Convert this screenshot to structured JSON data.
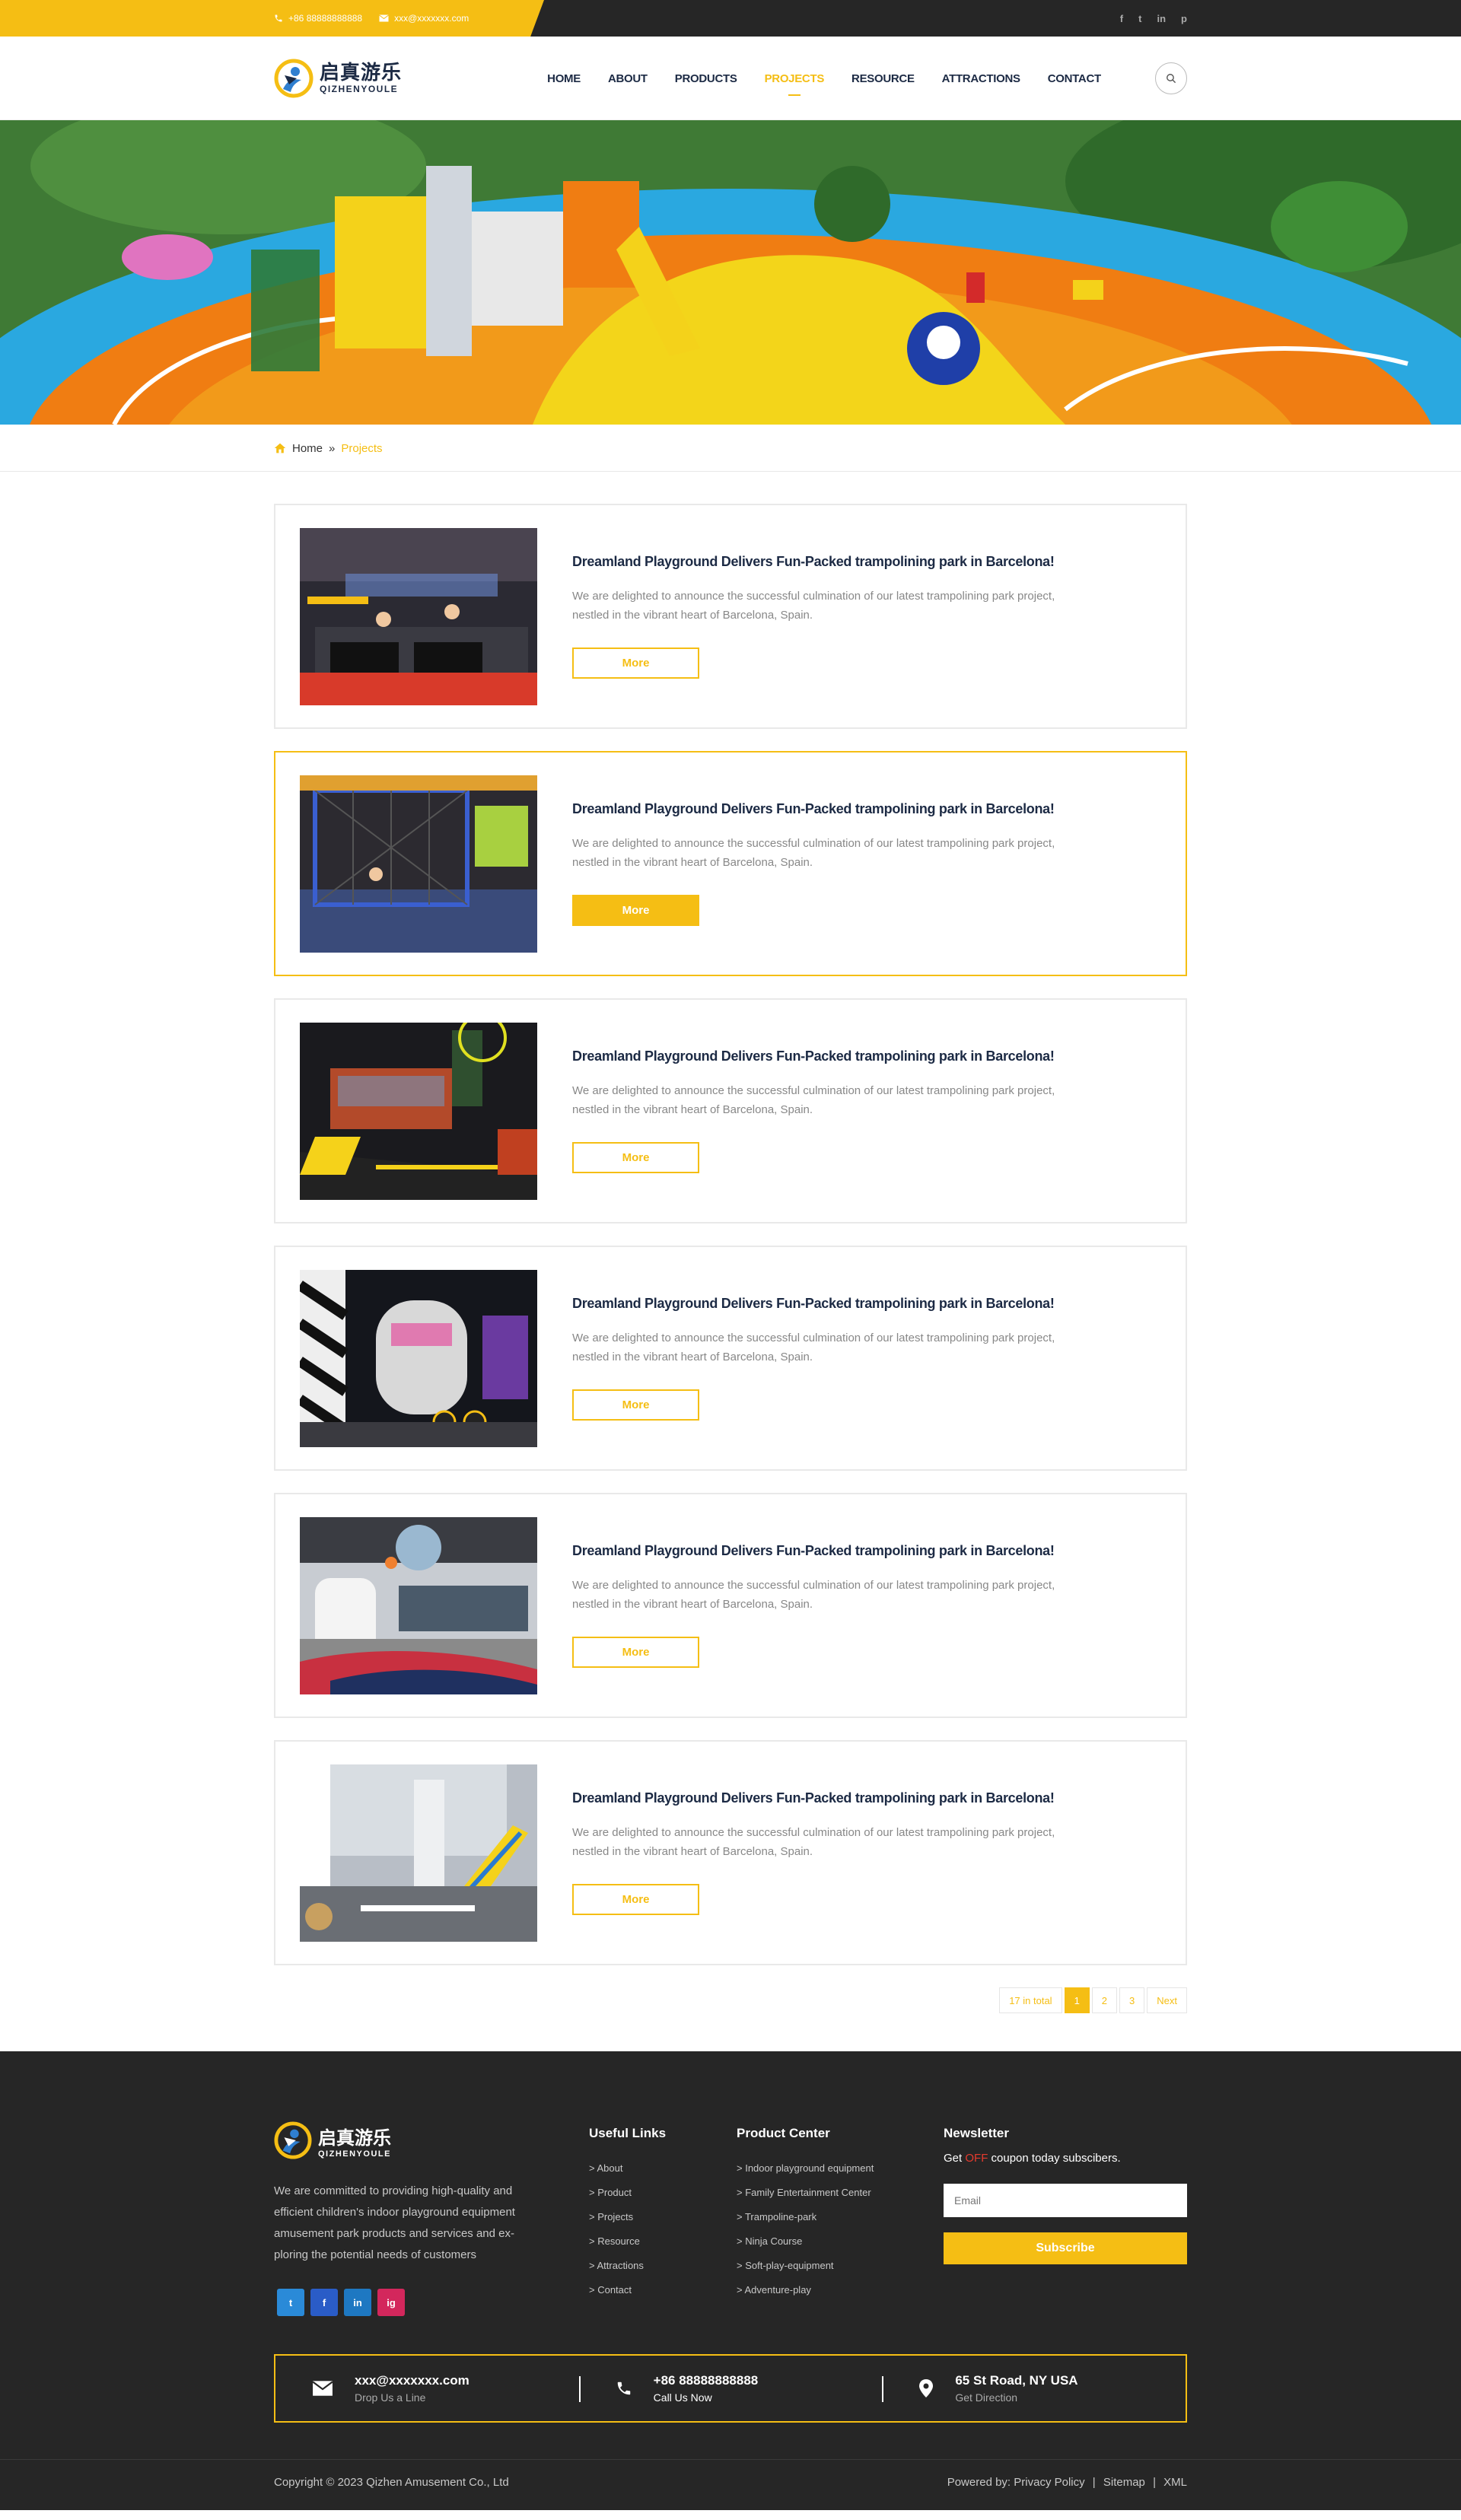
{
  "topbar": {
    "phone": "+86 88888888888",
    "email": "xxx@xxxxxxx.com",
    "social": [
      "f",
      "t",
      "in",
      "p"
    ]
  },
  "logo": {
    "cn": "启真游乐",
    "en": "QIZHENYOULE"
  },
  "nav": [
    {
      "label": "HOME",
      "active": false
    },
    {
      "label": "ABOUT",
      "active": false
    },
    {
      "label": "PRODUCTS",
      "active": false
    },
    {
      "label": "PROJECTS",
      "active": true
    },
    {
      "label": "RESOURCE",
      "active": false
    },
    {
      "label": "ATTRACTIONS",
      "active": false
    },
    {
      "label": "CONTACT",
      "active": false
    }
  ],
  "breadcrumb": {
    "home": "Home",
    "sep": "»",
    "current": "Projects"
  },
  "projects": [
    {
      "title": "Dreamland Playground Delivers Fun-Packed trampolining park in Barcelona!",
      "desc1": "We are delighted to announce the successful culmination of our latest trampolining park project,",
      "desc2": "nestled in the vibrant heart of Barcelona, Spain.",
      "more": "More"
    },
    {
      "title": "Dreamland Playground Delivers Fun-Packed trampolining park in Barcelona!",
      "desc1": "We are delighted to announce the successful culmination of our latest trampolining park project,",
      "desc2": "nestled in the vibrant heart of Barcelona, Spain.",
      "more": "More"
    },
    {
      "title": "Dreamland Playground Delivers Fun-Packed trampolining park in Barcelona!",
      "desc1": "We are delighted to announce the successful culmination of our latest trampolining park project,",
      "desc2": "nestled in the vibrant heart of Barcelona, Spain.",
      "more": "More"
    },
    {
      "title": "Dreamland Playground Delivers Fun-Packed trampolining park in Barcelona!",
      "desc1": "We are delighted to announce the successful culmination of our latest trampolining park project,",
      "desc2": "nestled in the vibrant heart of Barcelona, Spain.",
      "more": "More"
    },
    {
      "title": "Dreamland Playground Delivers Fun-Packed trampolining park in Barcelona!",
      "desc1": "We are delighted to announce the successful culmination of our latest trampolining park project,",
      "desc2": "nestled in the vibrant heart of Barcelona, Spain.",
      "more": "More"
    },
    {
      "title": "Dreamland Playground Delivers Fun-Packed trampolining park in Barcelona!",
      "desc1": "We are delighted to announce the successful culmination of our latest trampolining park project,",
      "desc2": "nestled in the vibrant heart of Barcelona, Spain.",
      "more": "More"
    }
  ],
  "pagination": {
    "total": "17 in total",
    "pages": [
      "1",
      "2",
      "3"
    ],
    "current": "1",
    "next": "Next"
  },
  "footer": {
    "about": "We are committed to providing high-quality and efficient children's indoor playground equipment amusement park products and services and ex-ploring the potential needs of customers",
    "social": [
      {
        "icon": "t",
        "color": "#2a8ad8"
      },
      {
        "icon": "f",
        "color": "#2a5cc7"
      },
      {
        "icon": "in",
        "color": "#1e78c2"
      },
      {
        "icon": "ig",
        "color": "#d3275c"
      }
    ],
    "useful_links_title": "Useful Links",
    "useful_links": [
      "> About",
      "> Product",
      "> Projects",
      "> Resource",
      "> Attractions",
      "> Contact"
    ],
    "product_center_title": "Product Center",
    "product_center": [
      "> Indoor playground equipment",
      "> Family Entertainment Center",
      "> Trampoline-park",
      "> Ninja Course",
      "> Soft-play-equipment",
      "> Adventure-play"
    ],
    "newsletter_title": "Newsletter",
    "newsletter_pre": "Get ",
    "newsletter_off": "OFF",
    "newsletter_post": " coupon today subscibers.",
    "email_placeholder": "Email",
    "subscribe": "Subscribe",
    "contacts": [
      {
        "main": "xxx@xxxxxxx.com",
        "sub": "Drop Us a Line",
        "icon": "mail-icon"
      },
      {
        "main": "+86 88888888888",
        "sub": "Call Us Now",
        "icon": "phone-icon"
      },
      {
        "main": "65 St Road, NY USA",
        "sub": "Get Direction",
        "icon": "location-icon"
      }
    ],
    "copyright": "Copyright © 2023 Qizhen Amusement Co., Ltd",
    "powered": "Powered by:",
    "links": [
      "Privacy Policy",
      "Sitemap",
      "XML"
    ]
  },
  "colors": {
    "accent": "#f5be14",
    "dark": "#262626",
    "navy": "#1c2a44"
  }
}
